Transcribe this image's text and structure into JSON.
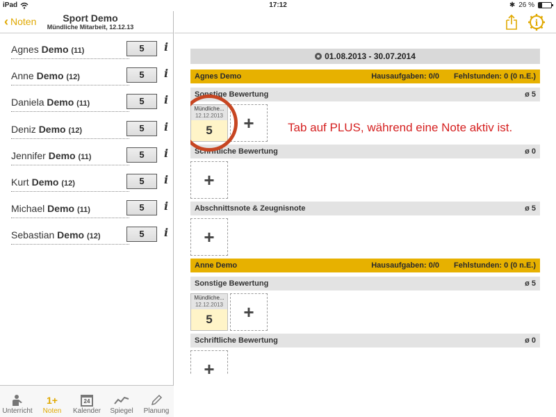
{
  "status": {
    "device": "iPad",
    "time": "17:12",
    "battery": "26 %",
    "battery_level": 0.26
  },
  "nav_left": {
    "back_label": "Noten",
    "title": "Sport Demo",
    "subtitle": "Mündliche Mitarbeit, 12.12.13"
  },
  "students": [
    {
      "first": "Agnes",
      "last": "Demo",
      "age": "(11)",
      "grade": "5"
    },
    {
      "first": "Anne",
      "last": "Demo",
      "age": "(12)",
      "grade": "5"
    },
    {
      "first": "Daniela",
      "last": "Demo",
      "age": "(11)",
      "grade": "5"
    },
    {
      "first": "Deniz",
      "last": "Demo",
      "age": "(12)",
      "grade": "5"
    },
    {
      "first": "Jennifer",
      "last": "Demo",
      "age": "(11)",
      "grade": "5"
    },
    {
      "first": "Kurt",
      "last": "Demo",
      "age": "(12)",
      "grade": "5"
    },
    {
      "first": "Michael",
      "last": "Demo",
      "age": "(11)",
      "grade": "5"
    },
    {
      "first": "Sebastian",
      "last": "Demo",
      "age": "(12)",
      "grade": "5"
    }
  ],
  "info_glyph": "i",
  "tabs": [
    {
      "label": "Unterricht",
      "icon": "teacher-icon"
    },
    {
      "label": "Noten",
      "icon": "grade-icon",
      "glyph": "1+"
    },
    {
      "label": "Kalender",
      "icon": "calendar-icon",
      "glyph": "24"
    },
    {
      "label": "Spiegel",
      "icon": "trend-icon"
    },
    {
      "label": "Planung",
      "icon": "pencil-icon"
    }
  ],
  "date_range": "01.08.2013 - 30.07.2014",
  "add_glyph": "+",
  "sections": {
    "s1": {
      "name": "Agnes Demo",
      "hausaufgaben": "Hausaufgaben: 0/0",
      "fehlstunden": "Fehlstunden: 0 (0 n.E.)",
      "c1": {
        "title": "Sonstige Bewertung",
        "avg": "ø 5",
        "grade": {
          "label": "Mündliche...",
          "date": "12.12.2013",
          "value": "5"
        }
      },
      "c2": {
        "title": "Schriftliche Bewertung",
        "avg": "ø 0"
      },
      "c3": {
        "title": "Abschnittsnote & Zeugnisnote",
        "avg": "ø 5"
      }
    },
    "s2": {
      "name": "Anne Demo",
      "hausaufgaben": "Hausaufgaben: 0/0",
      "fehlstunden": "Fehlstunden: 0 (0 n.E.)",
      "c1": {
        "title": "Sonstige Bewertung",
        "avg": "ø 5",
        "grade": {
          "label": "Mündliche...",
          "date": "12.12.2013",
          "value": "5"
        }
      },
      "c2": {
        "title": "Schriftliche Bewertung",
        "avg": "ø 0"
      }
    }
  },
  "annotation": "Tab auf PLUS, während eine Note aktiv ist.",
  "colors": {
    "accent": "#e0a800",
    "student_header": "#e7b100",
    "annotation": "#d51f1f",
    "circle": "#c74622"
  }
}
